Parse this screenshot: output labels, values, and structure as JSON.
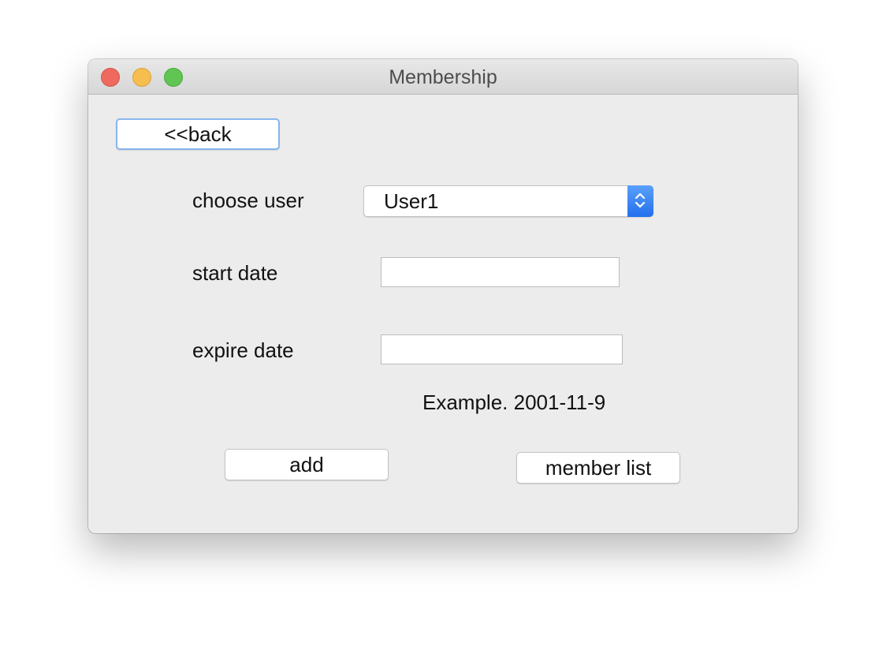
{
  "window": {
    "title": "Membership",
    "controls": [
      "close",
      "minimize",
      "zoom"
    ]
  },
  "back_button": {
    "label": "<<back"
  },
  "form": {
    "choose_user": {
      "label": "choose user",
      "selected": "User1"
    },
    "start_date": {
      "label": "start date",
      "value": ""
    },
    "expire_date": {
      "label": "expire date",
      "value": ""
    },
    "example_hint": "Example. 2001-11-9"
  },
  "actions": {
    "add_label": "add",
    "member_list_label": "member list"
  },
  "colors": {
    "close": "#ee6a5f",
    "minimize": "#f5be4f",
    "zoom": "#61c554",
    "select_accent": "#2f7cf4",
    "focus_ring": "#88b5ec"
  }
}
